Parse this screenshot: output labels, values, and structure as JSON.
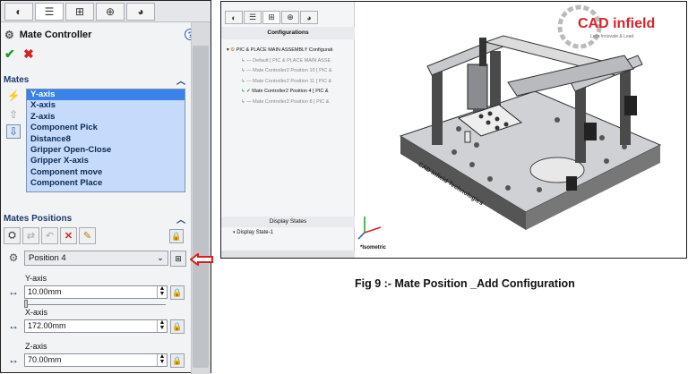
{
  "left_panel": {
    "title": "Mate Controller",
    "sections": {
      "mates": "Mates",
      "positions": "Mates Positions"
    },
    "mates": [
      "Y-axis",
      "X-axis",
      "Z-axis",
      "Component Pick",
      "Distance8",
      "Gripper Open-Close",
      "Gripper X-axis",
      "Component move",
      "Component Place"
    ],
    "selected_mate": "Y-axis",
    "position": {
      "selected": "Position 4"
    },
    "fields": [
      {
        "label": "Y-axis",
        "value": "10.00mm",
        "slider_fraction": 0.0
      },
      {
        "label": "X-axis",
        "value": "172.00mm"
      },
      {
        "label": "Z-axis",
        "value": "70.00mm"
      }
    ]
  },
  "config_pane": {
    "header": "Configurations",
    "tree": [
      "PIC & PLACE MAIN ASSEMBLY Configurati",
      "Default [ PIC & PLACE MAIN ASSE",
      "Mate Controller2 Position 10 [ PIC &",
      "Mate Controller2 Position 11 [ PIC &",
      "Mate Controller2 Position 4 [ PIC &",
      "Mate Controller2 Position 8 [ PIC &"
    ],
    "active_index": 4,
    "display_states_header": "Display States",
    "display_state": "Display State-1"
  },
  "viewport": {
    "logo_text": "CAD infield",
    "logo_sub": "Let's Innovate & Lead",
    "plate_text": "CAD Infield Technologies",
    "view_label": "*Isometric"
  },
  "caption": "Fig 9 :- Mate Position _Add Configuration",
  "colors": {
    "accent": "#3b82e8",
    "list_bg": "#c6dbfb",
    "ok": "#1e9a2a",
    "cancel": "#d62020",
    "logo_red": "#d8252a"
  }
}
